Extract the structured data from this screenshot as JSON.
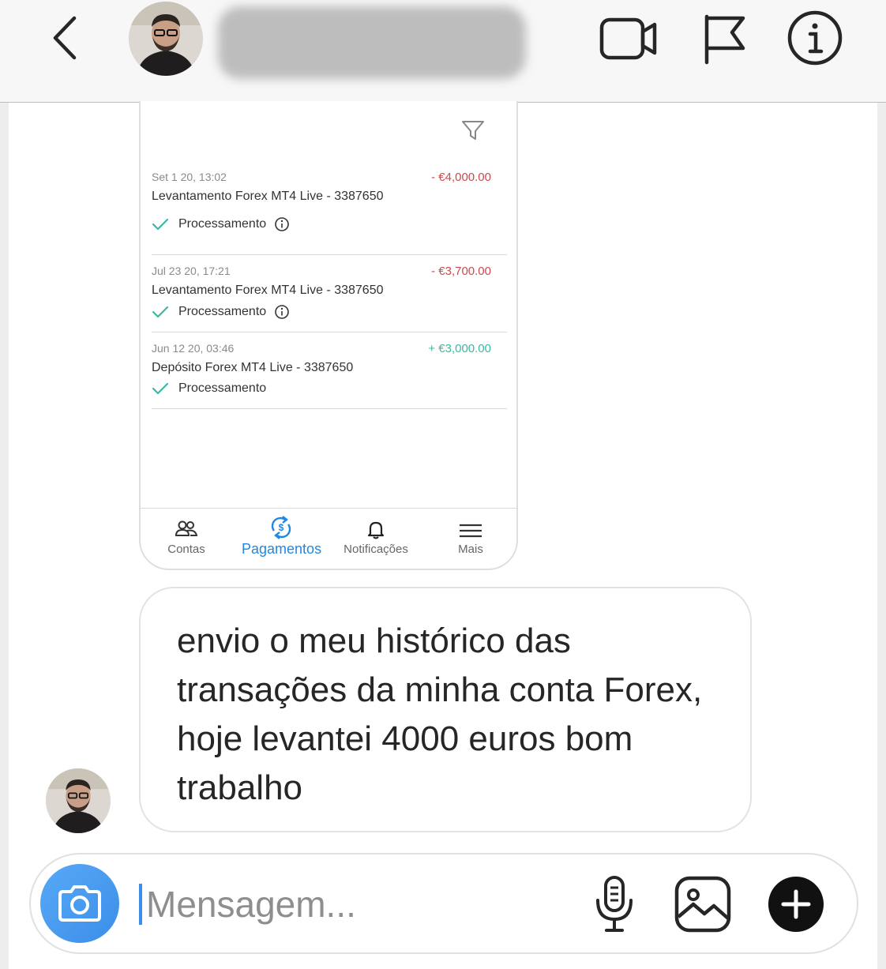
{
  "header": {
    "back_icon": "chevron-left-icon",
    "video_icon": "video-camera-icon",
    "report_icon": "flag-icon",
    "info_icon": "info-circle-icon"
  },
  "shared_screenshot": {
    "filter_icon": "filter-icon",
    "transactions": [
      {
        "date": "Set 1 20, 13:02",
        "title": "Levantamento Forex MT4 Live - 3387650",
        "amount": "- €4,000.00",
        "amount_color": "#c9494f",
        "status": "Processamento",
        "has_info": true
      },
      {
        "date": "Jul 23 20, 17:21",
        "title": "Levantamento Forex MT4 Live - 3387650",
        "amount": "- €3,700.00",
        "amount_color": "#c9494f",
        "status": "Processamento",
        "has_info": true
      },
      {
        "date": "Jun 12 20, 03:46",
        "title": "Depósito Forex MT4 Live - 3387650",
        "amount": "+ €3,000.00",
        "amount_color": "#3bb8a3",
        "status": "Processamento",
        "has_info": false
      }
    ],
    "tabs": [
      {
        "label": "Contas",
        "icon": "users-icon",
        "active": false
      },
      {
        "label": "Pagamentos",
        "icon": "payments-icon",
        "active": true
      },
      {
        "label": "Notificações",
        "icon": "bell-icon",
        "active": false
      },
      {
        "label": "Mais",
        "icon": "menu-icon",
        "active": false
      }
    ],
    "accent_color": "#1e88e5"
  },
  "message": {
    "text": "envio o meu histórico das transações da minha conta Forex, hoje levantei 4000 euros bom trabalho"
  },
  "composer": {
    "placeholder": "Mensagem...",
    "camera_icon": "camera-icon",
    "mic_icon": "microphone-icon",
    "gallery_icon": "image-icon",
    "add_icon": "plus-circle-icon"
  }
}
